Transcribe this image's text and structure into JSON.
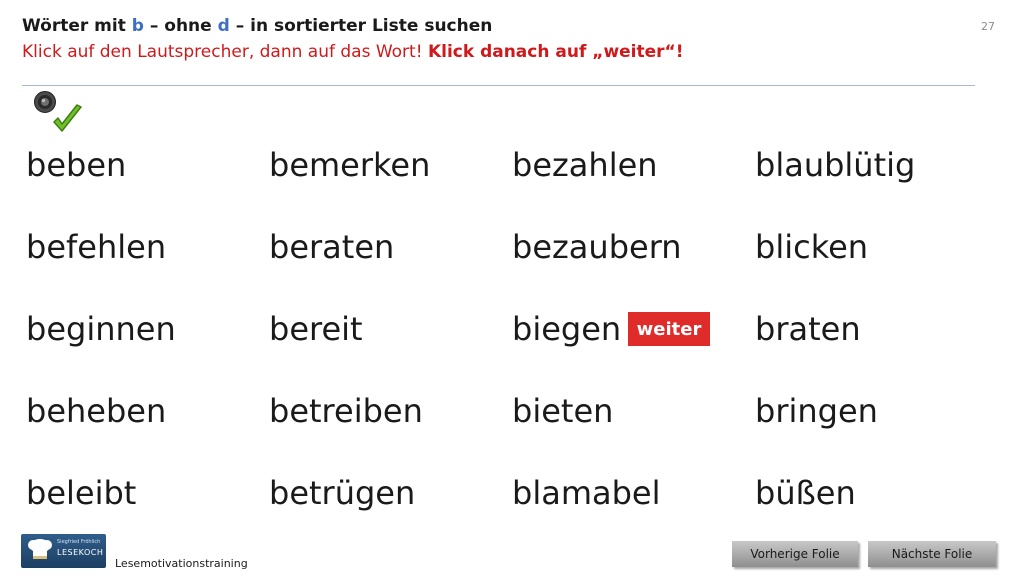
{
  "header": {
    "title_part1": "Wörter mit ",
    "title_b": "b",
    "title_part2": " – ohne ",
    "title_d": "d",
    "title_part3": " – in sortierter Liste suchen",
    "instruction_normal": "Klick auf den Lautsprecher, dann auf das Wort! ",
    "instruction_bold": "Klick danach auf „weiter“!",
    "page_number": "27"
  },
  "colors": {
    "accent_blue": "#3f6fc4",
    "instruction_red": "#d0191b",
    "button_red": "#e02b2b",
    "divider": "#aab9d3"
  },
  "icons": {
    "speaker": "speaker-icon",
    "checkmark": "checkmark-icon"
  },
  "words": {
    "col1": [
      "beben",
      "befehlen",
      "beginnen",
      "beheben",
      "beleibt"
    ],
    "col2": [
      "bemerken",
      "beraten",
      "bereit",
      "betreiben",
      "betrügen"
    ],
    "col3": [
      "bezahlen",
      "bezaubern",
      "biegen",
      "bieten",
      "blamabel"
    ],
    "col4": [
      "blaublütig",
      "blicken",
      "braten",
      "bringen",
      "büßen"
    ]
  },
  "weiter_label": "weiter",
  "footer": {
    "logo_small": "Siegfried Fröhlich",
    "logo_text": "LESEKOCH",
    "label": "Lesemotivationstraining",
    "prev_button": "Vorherige  Folie",
    "next_button": "Nächste  Folie"
  }
}
